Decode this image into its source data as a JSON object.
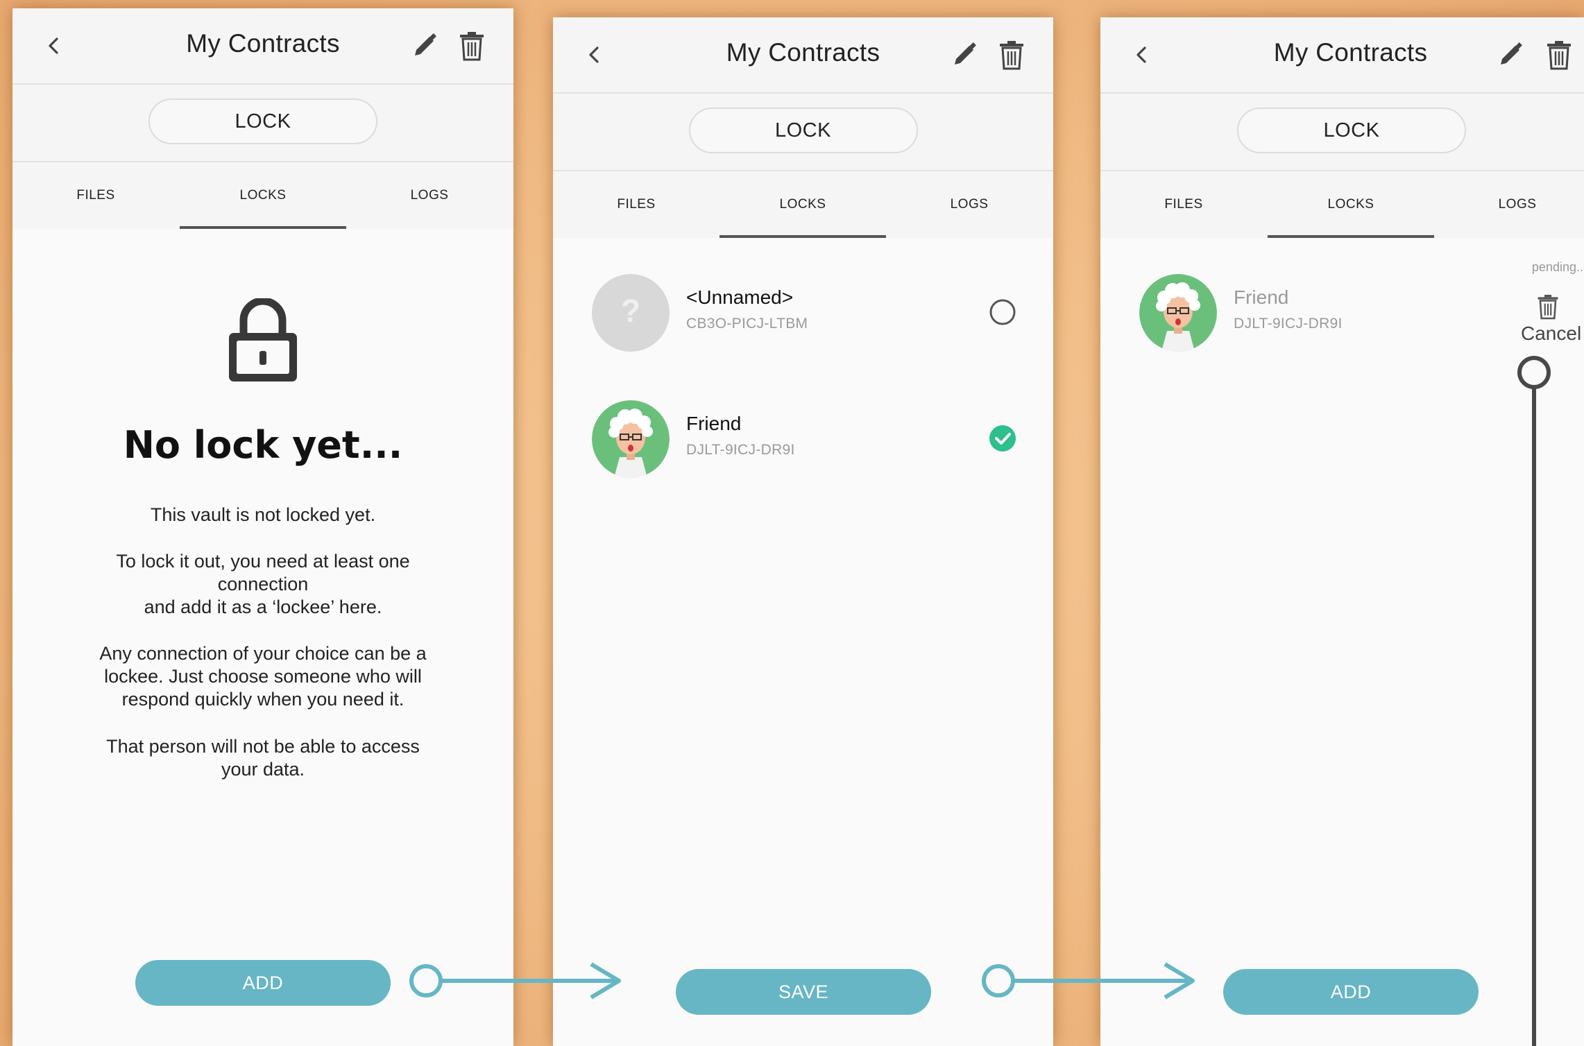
{
  "screens": [
    {
      "header": {
        "title": "My Contracts"
      },
      "lock_button": "LOCK",
      "tabs": [
        "FILES",
        "LOCKS",
        "LOGS"
      ],
      "empty": {
        "title": "No lock yet...",
        "p1": "This vault is not locked yet.",
        "p2_line1": "To lock it out, you need at least one",
        "p2_line2": "connection",
        "p2_line3": "and add it as a ‘lockee’ here.",
        "p3_line1": "Any connection of your choice can be a",
        "p3_line2": "lockee. Just choose someone who will",
        "p3_line3": "respond quickly when you need it.",
        "p4_line1": "That person will not be able to access",
        "p4_line2": "your data."
      },
      "action": "ADD"
    },
    {
      "header": {
        "title": "My Contracts"
      },
      "lock_button": "LOCK",
      "tabs": [
        "FILES",
        "LOCKS",
        "LOGS"
      ],
      "contacts": [
        {
          "name": "<Unnamed>",
          "id": "CB3O-PICJ-LTBM",
          "avatar_placeholder": "?",
          "selected": false
        },
        {
          "name": "Friend",
          "id": "DJLT-9ICJ-DR9I",
          "selected": true
        }
      ],
      "action": "SAVE"
    },
    {
      "header": {
        "title": "My Contracts"
      },
      "lock_button": "LOCK",
      "tabs": [
        "FILES",
        "LOCKS",
        "LOGS"
      ],
      "lockee": {
        "name": "Friend",
        "id": "DJLT-9ICJ-DR9I",
        "status": "pending...",
        "cancel_label": "Cancel"
      },
      "action": "ADD"
    }
  ],
  "colors": {
    "accent": "#66b6c5",
    "check": "#2dbf8c",
    "avatar_green": "#6ac07b",
    "background": "#f3bd88"
  },
  "icons": [
    "back-arrow-icon",
    "pencil-icon",
    "trash-icon",
    "padlock-icon",
    "radio-unchecked-icon",
    "check-circle-icon",
    "arrow-right-icon"
  ]
}
